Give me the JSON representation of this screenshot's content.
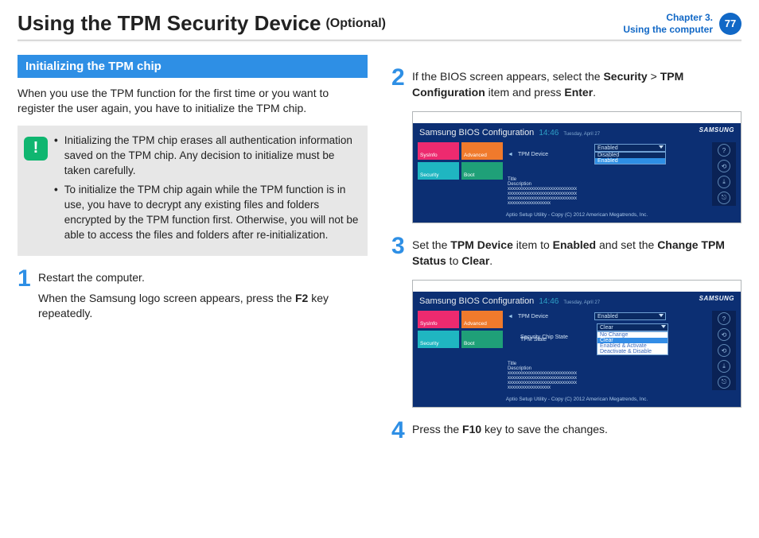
{
  "header": {
    "title": "Using the TPM Security Device",
    "optional": "(Optional)",
    "chapter_line1": "Chapter 3.",
    "chapter_line2": "Using the computer",
    "page": "77"
  },
  "left": {
    "section_title": "Initializing the TPM chip",
    "intro": "When you use the TPM function for the first time or you want to register the user again, you have to initialize the TPM chip.",
    "notes": [
      "Initializing the TPM chip erases all authentication information saved on the TPM chip. Any decision to initialize must be taken carefully.",
      "To initialize the TPM chip again while the TPM function is in use, you have to decrypt any existing files and folders encrypted by the TPM function first. Otherwise, you will not be able to access the files and folders after re-initialization."
    ],
    "step1_num": "1",
    "step1_a": "Restart the computer.",
    "step1_b_pre": "When the Samsung logo screen appears, press the ",
    "step1_b_key": "F2",
    "step1_b_post": " key repeatedly."
  },
  "right": {
    "step2_num": "2",
    "step2_pre": "If the BIOS screen appears, select the ",
    "step2_sec": "Security",
    "step2_gt": " > ",
    "step2_tpm": "TPM Configuration",
    "step2_post": " item and press ",
    "step2_enter": "Enter",
    "step2_period": ".",
    "step3_num": "3",
    "step3_pre": "Set the ",
    "step3_tpm": "TPM Device",
    "step3_mid1": " item to ",
    "step3_enabled": "Enabled",
    "step3_mid2": " and set the ",
    "step3_chg": "Change TPM Status",
    "step3_mid3": " to ",
    "step3_clear": "Clear",
    "step3_period": ".",
    "step4_num": "4",
    "step4_pre": "Press the ",
    "step4_key": "F10",
    "step4_post": " key to save the changes."
  },
  "bios": {
    "title": "Samsung BIOS Configuration",
    "clock": "14:46",
    "date": "Tuesday, April 27",
    "brand": "SAMSUNG",
    "tiles": {
      "sysinfo": "SysInfo",
      "advanced": "Advanced",
      "security": "Security",
      "boot": "Boot"
    },
    "label_tpm_device": "TPM Device",
    "label_tpm_state": "TPM State",
    "label_sec_chip": "Security Chip State",
    "opt_enabled": "Enabled",
    "opt_disabled": "Disabled",
    "opt_clear_hdr": "Clear",
    "opt_no_change": "No Change",
    "opt_clear": "Clear",
    "opt_en_act": "Enabled & Activate",
    "opt_de_dis": "Deactivate & Disable",
    "desc_title": "Title",
    "desc_body": "Description\nxxxxxxxxxxxxxxxxxxxxxxxxxxxxx\nxxxxxxxxxxxxxxxxxxxxxxxxxxxxx\nxxxxxxxxxxxxxxxxxxxxxxxxxxxxx\nxxxxxxxxxxxxxxxxxx",
    "footer": "Aptio Setup Utility - Copy (C) 2012 American Megatrends, Inc.",
    "right_icons": [
      "?",
      "⟲",
      "⤓",
      "⎋"
    ]
  }
}
